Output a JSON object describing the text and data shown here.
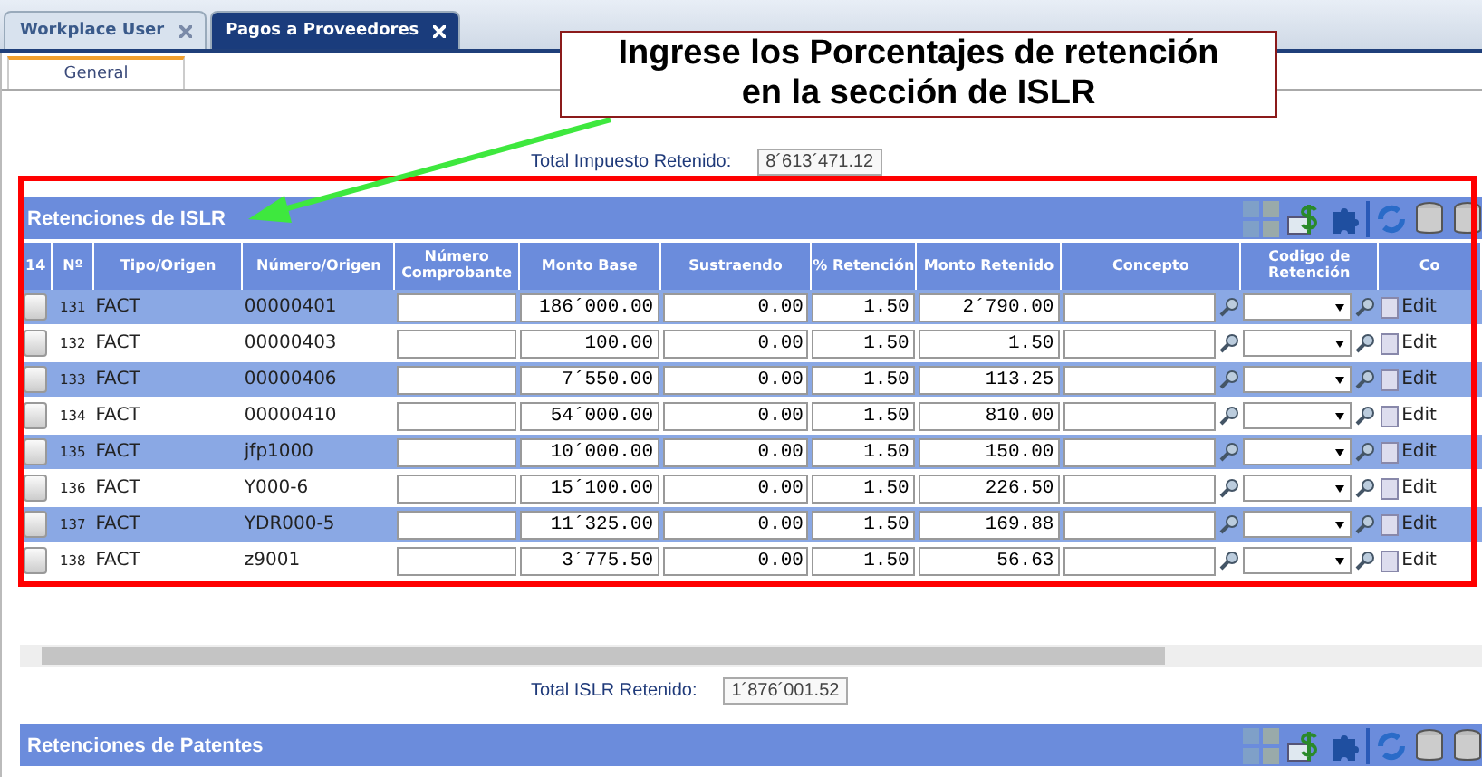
{
  "tabs": [
    {
      "label": "Workplace User",
      "selected": false
    },
    {
      "label": "Pagos a Proveedores",
      "selected": true
    }
  ],
  "subtabs": [
    {
      "label": "General",
      "selected": true
    }
  ],
  "callout": {
    "lines": [
      "Ingrese los Porcentajes de retención",
      "en la sección de ISLR"
    ]
  },
  "total_impuesto": {
    "label": "Total Impuesto Retenido:",
    "value": "8´613´471.12"
  },
  "islr": {
    "title": "Retenciones de ISLR",
    "columns": [
      "14",
      "Nº",
      "Tipo/Origen",
      "Número/Origen",
      "Número Comprobante",
      "Monto Base",
      "Sustraendo",
      "% Retención",
      "Monto Retenido",
      "Concepto",
      "Codigo de Retención",
      "Co"
    ],
    "rows": [
      {
        "checked": false,
        "n": "131",
        "tipo": "FACT",
        "numero": "00000401",
        "monto_base": "186´000.00",
        "sustraendo": "0.00",
        "porcentaje": "1.50",
        "monto_retenido": "2´790.00",
        "edit": "Edit"
      },
      {
        "checked": false,
        "n": "132",
        "tipo": "FACT",
        "numero": "00000403",
        "monto_base": "100.00",
        "sustraendo": "0.00",
        "porcentaje": "1.50",
        "monto_retenido": "1.50",
        "edit": "Edit"
      },
      {
        "checked": false,
        "n": "133",
        "tipo": "FACT",
        "numero": "00000406",
        "monto_base": "7´550.00",
        "sustraendo": "0.00",
        "porcentaje": "1.50",
        "monto_retenido": "113.25",
        "edit": "Edit"
      },
      {
        "checked": false,
        "n": "134",
        "tipo": "FACT",
        "numero": "00000410",
        "monto_base": "54´000.00",
        "sustraendo": "0.00",
        "porcentaje": "1.50",
        "monto_retenido": "810.00",
        "edit": "Edit"
      },
      {
        "checked": false,
        "n": "135",
        "tipo": "FACT",
        "numero": "jfp1000",
        "monto_base": "10´000.00",
        "sustraendo": "0.00",
        "porcentaje": "1.50",
        "monto_retenido": "150.00",
        "edit": "Edit"
      },
      {
        "checked": false,
        "n": "136",
        "tipo": "FACT",
        "numero": "Y000-6",
        "monto_base": "15´100.00",
        "sustraendo": "0.00",
        "porcentaje": "1.50",
        "monto_retenido": "226.50",
        "edit": "Edit"
      },
      {
        "checked": false,
        "n": "137",
        "tipo": "FACT",
        "numero": "YDR000-5",
        "monto_base": "11´325.00",
        "sustraendo": "0.00",
        "porcentaje": "1.50",
        "monto_retenido": "169.88",
        "edit": "Edit"
      },
      {
        "checked": false,
        "n": "138",
        "tipo": "FACT",
        "numero": "z9001",
        "monto_base": "3´775.50",
        "sustraendo": "0.00",
        "porcentaje": "1.50",
        "monto_retenido": "56.63",
        "edit": "Edit"
      }
    ]
  },
  "total_islr": {
    "label": "Total ISLR Retenido:",
    "value": "1´876´001.52"
  },
  "patentes": {
    "title": "Retenciones de Patentes"
  }
}
